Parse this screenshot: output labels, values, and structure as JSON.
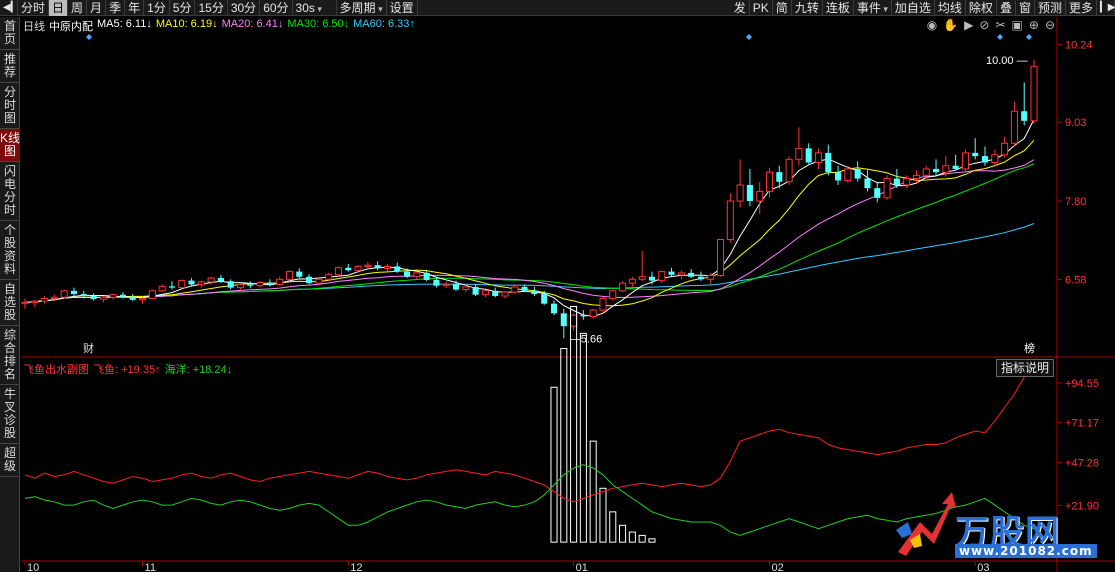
{
  "toolbar": {
    "periods": [
      {
        "label": "分时",
        "active": false
      },
      {
        "label": "日",
        "active": true
      },
      {
        "label": "周",
        "active": false
      },
      {
        "label": "月",
        "active": false
      },
      {
        "label": "季",
        "active": false
      },
      {
        "label": "年",
        "active": false
      },
      {
        "label": "1分",
        "active": false
      },
      {
        "label": "5分",
        "active": false
      },
      {
        "label": "15分",
        "active": false
      },
      {
        "label": "30分",
        "active": false
      },
      {
        "label": "60分",
        "active": false
      }
    ],
    "interval_select": "30s",
    "multi_period": "多周期",
    "settings": "设置",
    "right_items": [
      "发",
      "PK",
      "简",
      "九转",
      "连板",
      "事件",
      "加自选",
      "均线",
      "除权",
      "叠",
      "窗",
      "预测",
      "更多"
    ]
  },
  "sidebar": [
    {
      "label": "首页"
    },
    {
      "label": "推荐"
    },
    {
      "label": "分时图"
    },
    {
      "label": "K线图",
      "active": true
    },
    {
      "label": "闪电分时"
    },
    {
      "label": "个股资料"
    },
    {
      "label": "自选股"
    },
    {
      "label": "综合排名"
    },
    {
      "label": "牛叉诊股"
    },
    {
      "label": "超级"
    }
  ],
  "legend": {
    "period": "日线",
    "stock": "中原内配",
    "ma5": "MA5: 6.11↓",
    "ma10": "MA10: 6.19↓",
    "ma20": "MA20: 6.41↓",
    "ma30": "MA30: 6.50↓",
    "ma60": "MA60: 6.33↑"
  },
  "sub_legend": {
    "name": "飞鱼出水副图",
    "feiyu": "飞鱼: +19.35↑",
    "haiyang": "海洋: +18.24↓"
  },
  "indicator_button": "指标说明",
  "colors": {
    "up": "#ff3232",
    "down": "#54ffff",
    "ma5": "#ffffff",
    "ma10": "#ffff00",
    "ma20": "#ff80ff",
    "ma30": "#00e600",
    "ma60": "#33ccff",
    "axis": "#b00000",
    "feiyu": "#ff2020",
    "haiyang": "#20d020"
  },
  "chart_data": {
    "type": "candlestick",
    "price_axis_ticks": [
      "10.24",
      "9.03",
      "7.80",
      "6.58"
    ],
    "price_axis_values": [
      10.24,
      9.03,
      7.8,
      6.58
    ],
    "sub_axis_ticks": [
      "+94.55",
      "+71.17",
      "+47.28",
      "+21.90"
    ],
    "sub_axis_values": [
      94.55,
      71.17,
      47.28,
      21.9
    ],
    "month_labels": [
      "10",
      "11",
      "12",
      "01",
      "02",
      "03"
    ],
    "high_label": "10.00",
    "low_label": "5.66",
    "markers": [
      "财",
      "榜"
    ],
    "price_ylim": [
      5.4,
      10.45
    ],
    "candles": [
      [
        6.2,
        6.28,
        6.12,
        6.22
      ],
      [
        6.22,
        6.26,
        6.15,
        6.24
      ],
      [
        6.24,
        6.32,
        6.2,
        6.28
      ],
      [
        6.28,
        6.34,
        6.24,
        6.3
      ],
      [
        6.3,
        6.42,
        6.28,
        6.4
      ],
      [
        6.4,
        6.45,
        6.32,
        6.35
      ],
      [
        6.35,
        6.4,
        6.28,
        6.32
      ],
      [
        6.32,
        6.36,
        6.25,
        6.27
      ],
      [
        6.27,
        6.32,
        6.22,
        6.3
      ],
      [
        6.3,
        6.36,
        6.26,
        6.34
      ],
      [
        6.34,
        6.38,
        6.28,
        6.31
      ],
      [
        6.31,
        6.35,
        6.24,
        6.26
      ],
      [
        6.26,
        6.3,
        6.2,
        6.28
      ],
      [
        6.28,
        6.42,
        6.27,
        6.4
      ],
      [
        6.4,
        6.5,
        6.38,
        6.47
      ],
      [
        6.47,
        6.55,
        6.42,
        6.45
      ],
      [
        6.45,
        6.58,
        6.44,
        6.56
      ],
      [
        6.56,
        6.6,
        6.48,
        6.5
      ],
      [
        6.5,
        6.56,
        6.45,
        6.54
      ],
      [
        6.54,
        6.62,
        6.5,
        6.6
      ],
      [
        6.6,
        6.65,
        6.52,
        6.55
      ],
      [
        6.55,
        6.58,
        6.42,
        6.45
      ],
      [
        6.45,
        6.52,
        6.4,
        6.5
      ],
      [
        6.5,
        6.55,
        6.44,
        6.48
      ],
      [
        6.48,
        6.55,
        6.45,
        6.53
      ],
      [
        6.53,
        6.58,
        6.47,
        6.5
      ],
      [
        6.5,
        6.62,
        6.48,
        6.58
      ],
      [
        6.58,
        6.72,
        6.55,
        6.7
      ],
      [
        6.7,
        6.75,
        6.6,
        6.62
      ],
      [
        6.62,
        6.66,
        6.5,
        6.52
      ],
      [
        6.52,
        6.6,
        6.5,
        6.58
      ],
      [
        6.58,
        6.68,
        6.55,
        6.65
      ],
      [
        6.65,
        6.78,
        6.62,
        6.76
      ],
      [
        6.76,
        6.82,
        6.7,
        6.72
      ],
      [
        6.72,
        6.8,
        6.68,
        6.78
      ],
      [
        6.78,
        6.85,
        6.74,
        6.8
      ],
      [
        6.8,
        6.86,
        6.72,
        6.75
      ],
      [
        6.75,
        6.82,
        6.7,
        6.78
      ],
      [
        6.78,
        6.84,
        6.68,
        6.7
      ],
      [
        6.7,
        6.75,
        6.6,
        6.62
      ],
      [
        6.62,
        6.7,
        6.58,
        6.68
      ],
      [
        6.68,
        6.72,
        6.55,
        6.57
      ],
      [
        6.57,
        6.62,
        6.45,
        6.48
      ],
      [
        6.48,
        6.55,
        6.44,
        6.5
      ],
      [
        6.5,
        6.56,
        6.4,
        6.42
      ],
      [
        6.42,
        6.5,
        6.38,
        6.46
      ],
      [
        6.46,
        6.5,
        6.32,
        6.34
      ],
      [
        6.34,
        6.42,
        6.3,
        6.4
      ],
      [
        6.4,
        6.45,
        6.3,
        6.32
      ],
      [
        6.32,
        6.4,
        6.28,
        6.38
      ],
      [
        6.38,
        6.48,
        6.35,
        6.46
      ],
      [
        6.46,
        6.5,
        6.38,
        6.4
      ],
      [
        6.4,
        6.46,
        6.32,
        6.35
      ],
      [
        6.35,
        6.4,
        6.18,
        6.2
      ],
      [
        6.2,
        6.25,
        6.02,
        6.05
      ],
      [
        6.05,
        6.12,
        5.66,
        5.85
      ],
      [
        5.85,
        6.05,
        5.78,
        6.02
      ],
      [
        6.02,
        6.1,
        5.95,
        6.0
      ],
      [
        6.0,
        6.12,
        5.96,
        6.1
      ],
      [
        6.1,
        6.3,
        6.05,
        6.28
      ],
      [
        6.28,
        6.42,
        6.25,
        6.4
      ],
      [
        6.4,
        6.55,
        6.38,
        6.52
      ],
      [
        6.52,
        6.62,
        6.45,
        6.58
      ],
      [
        6.58,
        7.02,
        6.55,
        6.62
      ],
      [
        6.62,
        6.7,
        6.5,
        6.56
      ],
      [
        6.56,
        6.72,
        6.52,
        6.7
      ],
      [
        6.7,
        6.76,
        6.62,
        6.65
      ],
      [
        6.65,
        6.72,
        6.58,
        6.68
      ],
      [
        6.68,
        6.74,
        6.6,
        6.62
      ],
      [
        6.62,
        6.7,
        6.55,
        6.58
      ],
      [
        6.58,
        6.68,
        6.5,
        6.64
      ],
      [
        6.64,
        7.2,
        6.62,
        7.2
      ],
      [
        7.2,
        7.92,
        7.15,
        7.8
      ],
      [
        7.8,
        8.45,
        7.7,
        8.05
      ],
      [
        8.05,
        8.3,
        7.72,
        7.8
      ],
      [
        7.8,
        8.1,
        7.6,
        7.95
      ],
      [
        7.95,
        8.32,
        7.85,
        8.25
      ],
      [
        8.25,
        8.35,
        8.0,
        8.1
      ],
      [
        8.1,
        8.5,
        8.05,
        8.45
      ],
      [
        8.45,
        8.95,
        8.35,
        8.62
      ],
      [
        8.62,
        8.7,
        8.38,
        8.4
      ],
      [
        8.4,
        8.62,
        8.3,
        8.55
      ],
      [
        8.55,
        8.68,
        8.2,
        8.25
      ],
      [
        8.25,
        8.35,
        8.05,
        8.12
      ],
      [
        8.12,
        8.35,
        8.08,
        8.3
      ],
      [
        8.3,
        8.42,
        8.1,
        8.15
      ],
      [
        8.15,
        8.28,
        7.95,
        8.0
      ],
      [
        8.0,
        8.1,
        7.78,
        7.85
      ],
      [
        7.85,
        8.2,
        7.82,
        8.15
      ],
      [
        8.15,
        8.3,
        8.0,
        8.05
      ],
      [
        8.05,
        8.2,
        8.0,
        8.15
      ],
      [
        8.15,
        8.28,
        8.08,
        8.2
      ],
      [
        8.2,
        8.35,
        8.12,
        8.3
      ],
      [
        8.3,
        8.45,
        8.2,
        8.25
      ],
      [
        8.25,
        8.5,
        8.18,
        8.35
      ],
      [
        8.35,
        8.52,
        8.28,
        8.3
      ],
      [
        8.3,
        8.6,
        8.25,
        8.55
      ],
      [
        8.55,
        8.78,
        8.45,
        8.5
      ],
      [
        8.5,
        8.65,
        8.35,
        8.4
      ],
      [
        8.4,
        8.6,
        8.35,
        8.52
      ],
      [
        8.52,
        8.8,
        8.48,
        8.7
      ],
      [
        8.7,
        9.35,
        8.65,
        9.2
      ],
      [
        9.2,
        9.65,
        8.98,
        9.05
      ],
      [
        9.05,
        10.0,
        9.0,
        9.9
      ]
    ],
    "feiyu": [
      40,
      38,
      41,
      39,
      40,
      42,
      40,
      38,
      36,
      35,
      37,
      39,
      38,
      36,
      37,
      38,
      40,
      41,
      39,
      38,
      40,
      41,
      39,
      37,
      36,
      38,
      39,
      40,
      41,
      42,
      41,
      40,
      39,
      38,
      40,
      42,
      41,
      39,
      38,
      37,
      38,
      40,
      41,
      42,
      43,
      42,
      41,
      40,
      42,
      41,
      40,
      38,
      36,
      34,
      30,
      26,
      24,
      26,
      28,
      30,
      32,
      33,
      34,
      35,
      34,
      33,
      34,
      35,
      34,
      33,
      34,
      38,
      48,
      60,
      62,
      64,
      66,
      67,
      65,
      64,
      63,
      62,
      58,
      56,
      55,
      54,
      53,
      52,
      53,
      54,
      56,
      57,
      58,
      58,
      59,
      62,
      64,
      66,
      65,
      72,
      80,
      88,
      98,
      105
    ],
    "haiyang": [
      26,
      27,
      25,
      24,
      22,
      22,
      24,
      25,
      22,
      20,
      22,
      24,
      25,
      24,
      22,
      22,
      24,
      26,
      25,
      23,
      22,
      24,
      25,
      24,
      22,
      20,
      19,
      20,
      22,
      23,
      22,
      18,
      14,
      10,
      10,
      12,
      15,
      18,
      20,
      22,
      24,
      25,
      24,
      22,
      21,
      20,
      22,
      23,
      24,
      22,
      21,
      22,
      24,
      28,
      34,
      40,
      44,
      46,
      44,
      40,
      34,
      30,
      26,
      22,
      18,
      16,
      14,
      13,
      12,
      12,
      12,
      10,
      6,
      4,
      6,
      8,
      10,
      12,
      14,
      12,
      10,
      8,
      10,
      12,
      14,
      15,
      16,
      14,
      13,
      12,
      14,
      15,
      16,
      17,
      19,
      21,
      22,
      24,
      26,
      22,
      18,
      14,
      10,
      8
    ],
    "bars": {
      "start_index": 53,
      "values": [
        0,
        92,
        115,
        140,
        124,
        60,
        32,
        18,
        10,
        6,
        4,
        2
      ]
    },
    "sub_ylim": [
      -10,
      107
    ]
  }
}
